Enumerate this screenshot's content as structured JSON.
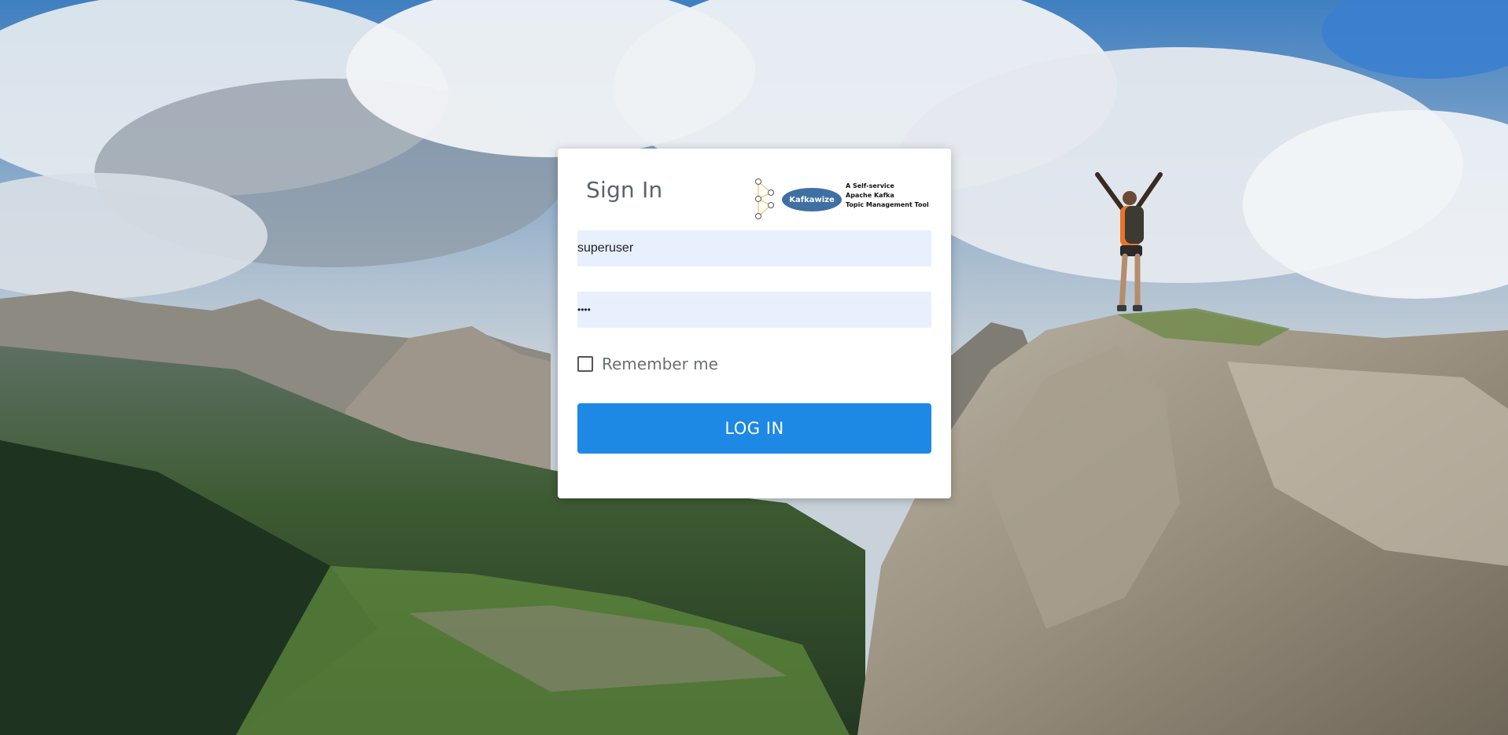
{
  "page": {
    "title": "Sign In"
  },
  "logo": {
    "name": "Kafkawize",
    "tagline_lines": [
      "A Self-service",
      "Apache Kafka",
      "Topic Management Tool"
    ],
    "icon": "network-nodes-icon",
    "color": "#3f70a4"
  },
  "form": {
    "username_value": "superuser",
    "password_value": "••••",
    "remember_label": "Remember me",
    "remember_checked": false,
    "login_label": "LOG IN"
  },
  "colors": {
    "button": "#1e88e5",
    "input_background": "#e8f0fe",
    "card_background": "#ffffff"
  }
}
